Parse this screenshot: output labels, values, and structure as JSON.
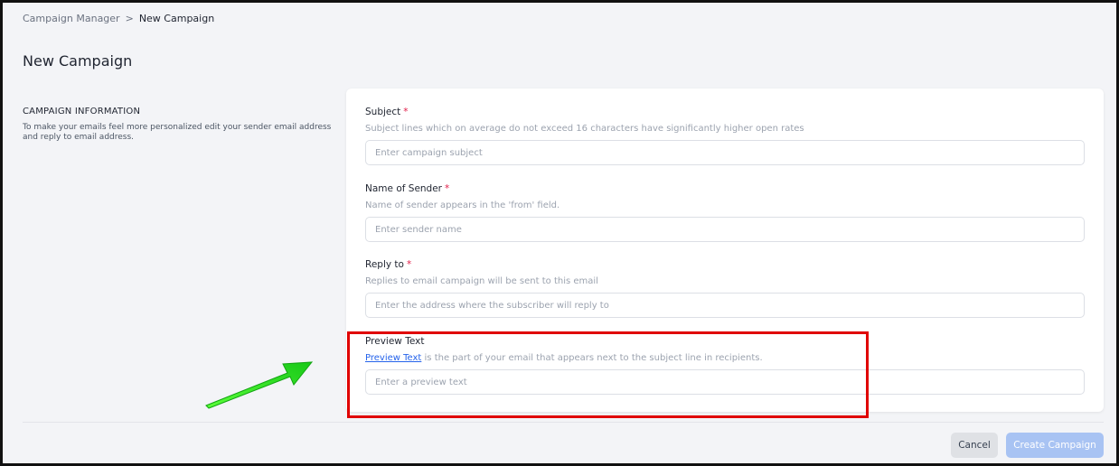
{
  "breadcrumb": {
    "root": "Campaign Manager",
    "separator": ">",
    "current": "New Campaign"
  },
  "page": {
    "title": "New Campaign"
  },
  "section": {
    "title": "CAMPAIGN INFORMATION",
    "description": "To make your emails feel more personalized edit your sender email address and reply to email address."
  },
  "fields": {
    "subject": {
      "label": "Subject",
      "required_mark": "*",
      "help": "Subject lines which on average do not exceed 16 characters have significantly higher open rates",
      "placeholder": "Enter campaign subject",
      "value": ""
    },
    "sender": {
      "label": "Name of Sender",
      "required_mark": "*",
      "help": "Name of sender appears in the 'from' field.",
      "placeholder": "Enter sender name",
      "value": ""
    },
    "reply_to": {
      "label": "Reply to",
      "required_mark": "*",
      "help": "Replies to email campaign will be sent to this email",
      "placeholder": "Enter the address where the subscriber will reply to",
      "value": ""
    },
    "preview_text": {
      "label": "Preview Text",
      "help_link": "Preview Text",
      "help": " is the part of your email that appears next to the subject line in recipients.",
      "placeholder": "Enter a preview text",
      "value": ""
    }
  },
  "actions": {
    "cancel": "Cancel",
    "create": "Create Campaign"
  },
  "annotations": {
    "highlight_color": "#e00000",
    "arrow_color": "#22dd22",
    "arrow_icon": "green-arrow-icon"
  },
  "colors": {
    "primary_disabled": "#a8c3f3",
    "required": "#e11d48",
    "link": "#2563eb"
  }
}
